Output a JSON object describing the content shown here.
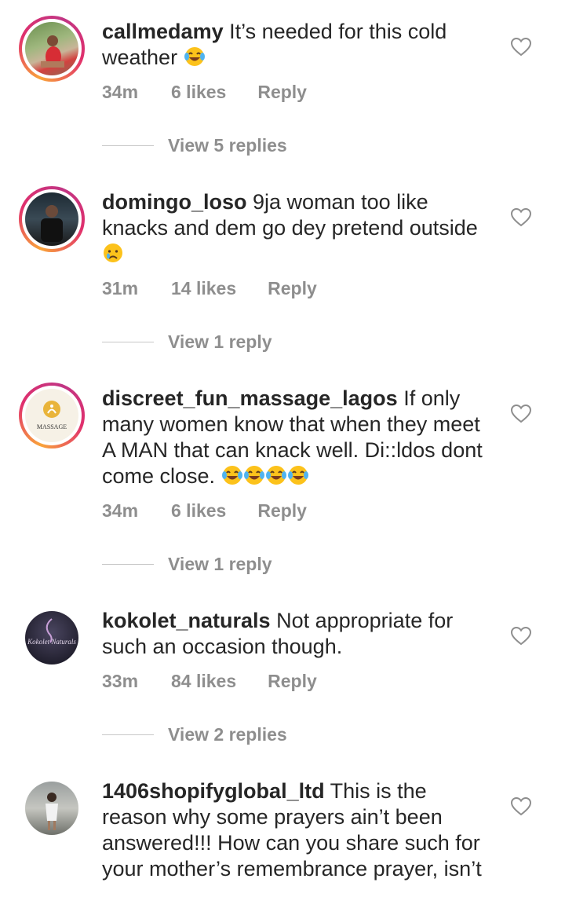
{
  "comments": [
    {
      "username": "callmedamy",
      "text": "It’s needed for this cold weather",
      "emoji_count": 1,
      "emoji": "laugh-cry",
      "time": "34m",
      "likes": "6 likes",
      "reply": "Reply",
      "view_replies": "View 5 replies"
    },
    {
      "username": "domingo_loso",
      "text": "9ja woman too like knacks and dem go dey pretend outside",
      "emoji_count": 1,
      "emoji": "crying",
      "time": "31m",
      "likes": "14 likes",
      "reply": "Reply",
      "view_replies": "View 1 reply"
    },
    {
      "username": "discreet_fun_massage_lagos",
      "text": "If only many women know that when they meet A MAN that can knack well. Di::ldos dont come close.",
      "emoji_count": 4,
      "emoji": "laugh-cry",
      "avatar_text": "MASSAGE",
      "time": "34m",
      "likes": "6 likes",
      "reply": "Reply",
      "view_replies": "View 1 reply"
    },
    {
      "username": "kokolet_naturals",
      "text": "Not appropriate for such an occasion though.",
      "avatar_text": "Kokolet Naturals",
      "time": "33m",
      "likes": "84 likes",
      "reply": "Reply",
      "view_replies": "View 2 replies"
    },
    {
      "username": "1406shopifyglobal_ltd",
      "text": "This is the reason why some prayers ain’t been answered!!! How can you share such for your mother’s remembrance prayer, isn’t"
    }
  ],
  "colors": {
    "text": "#262626",
    "secondary": "#8e8e8e",
    "story_ring_start": "#f9a43a",
    "story_ring_end": "#c13584"
  }
}
